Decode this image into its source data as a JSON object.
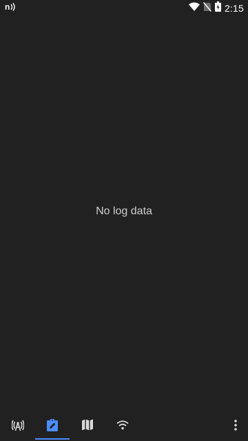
{
  "status_bar": {
    "time": "2:15",
    "icons": [
      "nfc-icon",
      "wifi-icon",
      "no-sim-icon",
      "battery-icon"
    ]
  },
  "main": {
    "empty_message": "No log data"
  },
  "bottom_nav": {
    "tabs": [
      {
        "icon": "cell-tower-icon",
        "selected": false
      },
      {
        "icon": "clipboard-edit-icon",
        "selected": true
      },
      {
        "icon": "map-icon",
        "selected": false
      },
      {
        "icon": "wifi-icon",
        "selected": false
      }
    ],
    "overflow_icon": "more-vert-icon"
  },
  "colors": {
    "background": "#212121",
    "accent": "#4d8dff",
    "icon": "#d9d9d9",
    "text": "#cfcfcf"
  }
}
